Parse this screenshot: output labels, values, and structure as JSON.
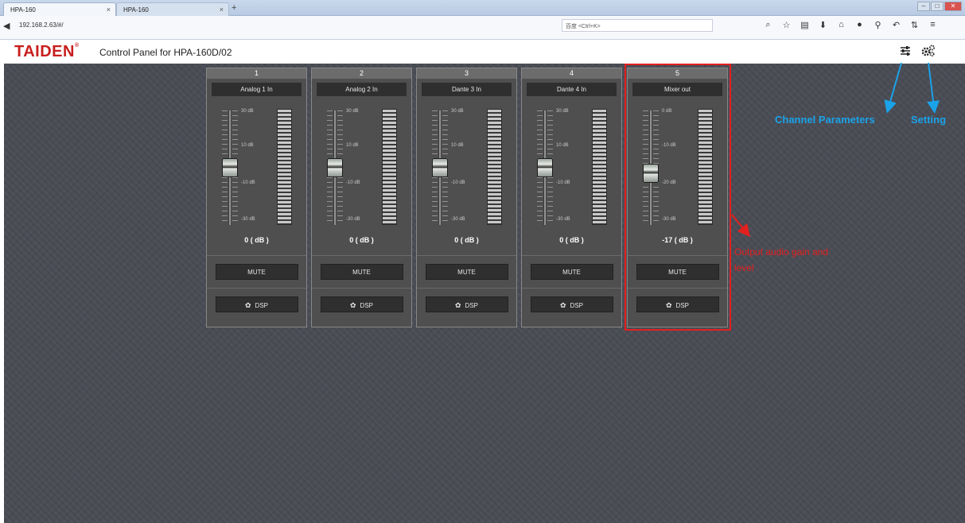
{
  "browser": {
    "tabs": [
      {
        "label": "HPA-160",
        "close": "×"
      },
      {
        "label": "HPA-160",
        "close": "×"
      }
    ],
    "new_tab": "+",
    "url": "192.168.2.63/#/",
    "search_placeholder": "百度 <Ctrl+K>"
  },
  "app": {
    "logo": "TAIDEN",
    "logo_mark": "®",
    "title": "Control Panel for HPA-160D/02"
  },
  "channels": [
    {
      "number": "1",
      "name": "Analog 1 In",
      "scale": [
        "30 dB",
        "10 dB",
        "-10 dB",
        "-30 dB"
      ],
      "gain": "0 ( dB )",
      "gain_value_db": 0,
      "mute": "MUTE",
      "dsp": "DSP"
    },
    {
      "number": "2",
      "name": "Analog 2 In",
      "scale": [
        "30 dB",
        "10 dB",
        "-10 dB",
        "-30 dB"
      ],
      "gain": "0 ( dB )",
      "gain_value_db": 0,
      "mute": "MUTE",
      "dsp": "DSP"
    },
    {
      "number": "3",
      "name": "Dante 3 In",
      "scale": [
        "30 dB",
        "10 dB",
        "-10 dB",
        "-30 dB"
      ],
      "gain": "0 ( dB )",
      "gain_value_db": 0,
      "mute": "MUTE",
      "dsp": "DSP"
    },
    {
      "number": "4",
      "name": "Dante 4 In",
      "scale": [
        "30 dB",
        "10 dB",
        "-10 dB",
        "-30 dB"
      ],
      "gain": "0 ( dB )",
      "gain_value_db": 0,
      "mute": "MUTE",
      "dsp": "DSP"
    },
    {
      "number": "5",
      "name": "Mixer out",
      "scale": [
        "0 dB",
        "-10 dB",
        "-20 dB",
        "-30 dB"
      ],
      "gain": "-17 ( dB )",
      "gain_value_db": -17,
      "mute": "MUTE",
      "dsp": "DSP"
    }
  ],
  "annotations": {
    "output": "Output audio gain and level",
    "channel_parameters": "Channel Parameters",
    "setting": "Setting"
  },
  "colors": {
    "brand_red": "#c81e1e",
    "highlight_red": "#e32020",
    "annotation_blue": "#1aa3e8"
  },
  "icons": {
    "channel_parameters": "sliders-icon",
    "setting": "gears-icon"
  }
}
